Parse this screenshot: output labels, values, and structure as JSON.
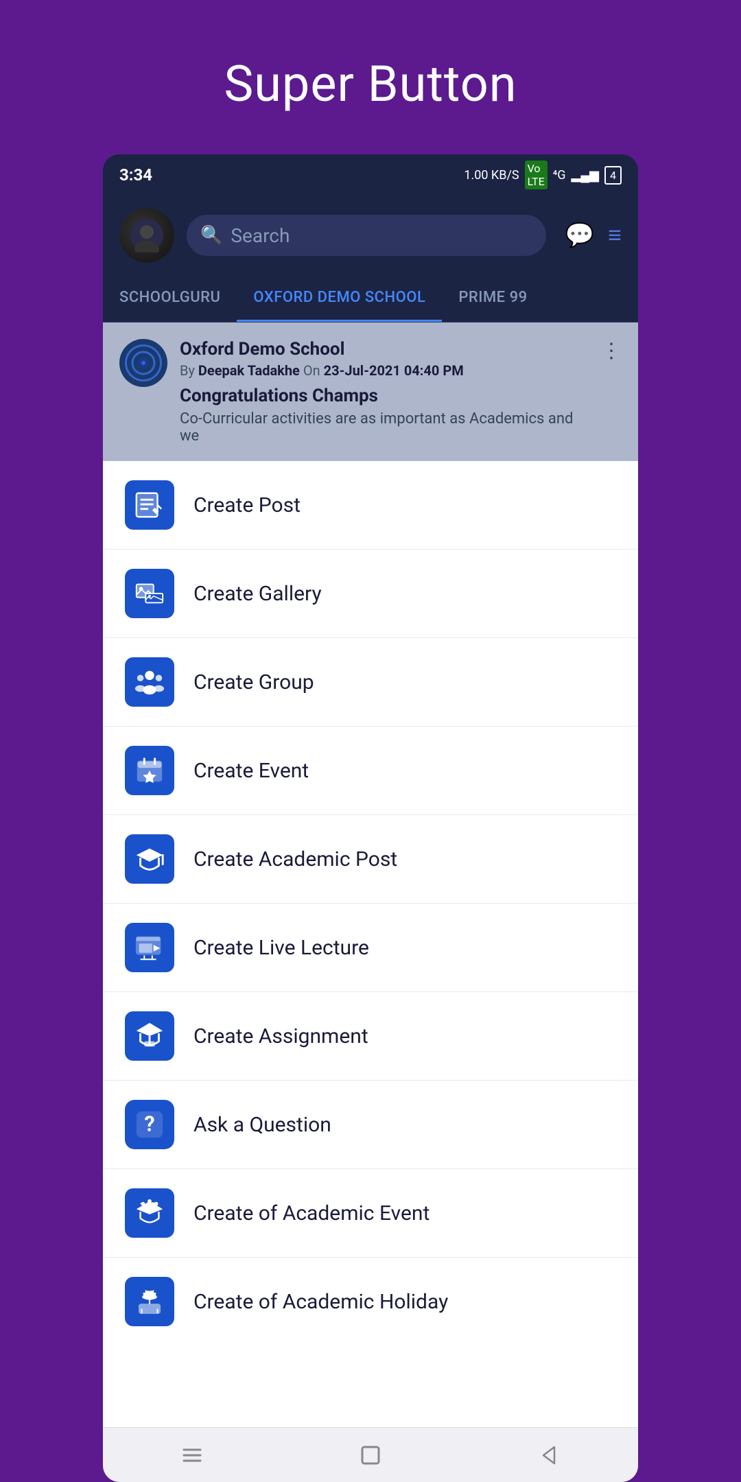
{
  "page": {
    "title": "Super Button"
  },
  "status_bar": {
    "time": "3:34",
    "data_speed": "1.00 KB/S",
    "network": "VoLTE",
    "signal": "4G"
  },
  "header": {
    "search_placeholder": "Search",
    "avatar_label": "User Avatar"
  },
  "tabs": [
    {
      "label": "SCHOOLGURU",
      "active": false
    },
    {
      "label": "OXFORD DEMO SCHOOL",
      "active": true
    },
    {
      "label": "PRIME 99",
      "active": false
    }
  ],
  "post": {
    "school_name": "Oxford Demo School",
    "author": "Deepak Tadakhe",
    "date": "23-Jul-2021 04:40 PM",
    "title": "Congratulations Champs",
    "body": "Co-Curricular activities are as important as Academics and we"
  },
  "menu_items": [
    {
      "id": "create-post",
      "label": "Create Post",
      "icon": "post"
    },
    {
      "id": "create-gallery",
      "label": "Create Gallery",
      "icon": "gallery"
    },
    {
      "id": "create-group",
      "label": "Create Group",
      "icon": "group"
    },
    {
      "id": "create-event",
      "label": "Create Event",
      "icon": "event"
    },
    {
      "id": "create-academic-post",
      "label": "Create Academic Post",
      "icon": "academic-post"
    },
    {
      "id": "create-live-lecture",
      "label": "Create Live Lecture",
      "icon": "live-lecture"
    },
    {
      "id": "create-assignment",
      "label": "Create Assignment",
      "icon": "assignment"
    },
    {
      "id": "ask-question",
      "label": "Ask a Question",
      "icon": "question"
    },
    {
      "id": "create-academic-event",
      "label": "Create of Academic Event",
      "icon": "academic-event"
    },
    {
      "id": "create-academic-holiday",
      "label": "Create of Academic Holiday",
      "icon": "academic-holiday"
    }
  ],
  "bottom_nav": {
    "menu_icon": "≡",
    "home_icon": "□",
    "back_icon": "◁"
  }
}
